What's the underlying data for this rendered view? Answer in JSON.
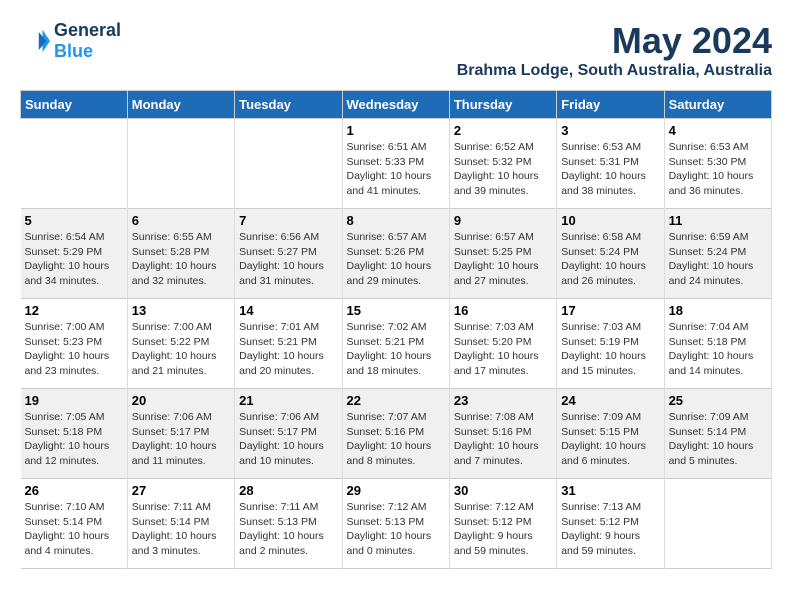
{
  "header": {
    "logo_line1": "General",
    "logo_line2": "Blue",
    "title": "May 2024",
    "subtitle": "Brahma Lodge, South Australia, Australia"
  },
  "weekdays": [
    "Sunday",
    "Monday",
    "Tuesday",
    "Wednesday",
    "Thursday",
    "Friday",
    "Saturday"
  ],
  "weeks": [
    [
      {
        "day": "",
        "info": ""
      },
      {
        "day": "",
        "info": ""
      },
      {
        "day": "",
        "info": ""
      },
      {
        "day": "1",
        "info": "Sunrise: 6:51 AM\nSunset: 5:33 PM\nDaylight: 10 hours\nand 41 minutes."
      },
      {
        "day": "2",
        "info": "Sunrise: 6:52 AM\nSunset: 5:32 PM\nDaylight: 10 hours\nand 39 minutes."
      },
      {
        "day": "3",
        "info": "Sunrise: 6:53 AM\nSunset: 5:31 PM\nDaylight: 10 hours\nand 38 minutes."
      },
      {
        "day": "4",
        "info": "Sunrise: 6:53 AM\nSunset: 5:30 PM\nDaylight: 10 hours\nand 36 minutes."
      }
    ],
    [
      {
        "day": "5",
        "info": "Sunrise: 6:54 AM\nSunset: 5:29 PM\nDaylight: 10 hours\nand 34 minutes."
      },
      {
        "day": "6",
        "info": "Sunrise: 6:55 AM\nSunset: 5:28 PM\nDaylight: 10 hours\nand 32 minutes."
      },
      {
        "day": "7",
        "info": "Sunrise: 6:56 AM\nSunset: 5:27 PM\nDaylight: 10 hours\nand 31 minutes."
      },
      {
        "day": "8",
        "info": "Sunrise: 6:57 AM\nSunset: 5:26 PM\nDaylight: 10 hours\nand 29 minutes."
      },
      {
        "day": "9",
        "info": "Sunrise: 6:57 AM\nSunset: 5:25 PM\nDaylight: 10 hours\nand 27 minutes."
      },
      {
        "day": "10",
        "info": "Sunrise: 6:58 AM\nSunset: 5:24 PM\nDaylight: 10 hours\nand 26 minutes."
      },
      {
        "day": "11",
        "info": "Sunrise: 6:59 AM\nSunset: 5:24 PM\nDaylight: 10 hours\nand 24 minutes."
      }
    ],
    [
      {
        "day": "12",
        "info": "Sunrise: 7:00 AM\nSunset: 5:23 PM\nDaylight: 10 hours\nand 23 minutes."
      },
      {
        "day": "13",
        "info": "Sunrise: 7:00 AM\nSunset: 5:22 PM\nDaylight: 10 hours\nand 21 minutes."
      },
      {
        "day": "14",
        "info": "Sunrise: 7:01 AM\nSunset: 5:21 PM\nDaylight: 10 hours\nand 20 minutes."
      },
      {
        "day": "15",
        "info": "Sunrise: 7:02 AM\nSunset: 5:21 PM\nDaylight: 10 hours\nand 18 minutes."
      },
      {
        "day": "16",
        "info": "Sunrise: 7:03 AM\nSunset: 5:20 PM\nDaylight: 10 hours\nand 17 minutes."
      },
      {
        "day": "17",
        "info": "Sunrise: 7:03 AM\nSunset: 5:19 PM\nDaylight: 10 hours\nand 15 minutes."
      },
      {
        "day": "18",
        "info": "Sunrise: 7:04 AM\nSunset: 5:18 PM\nDaylight: 10 hours\nand 14 minutes."
      }
    ],
    [
      {
        "day": "19",
        "info": "Sunrise: 7:05 AM\nSunset: 5:18 PM\nDaylight: 10 hours\nand 12 minutes."
      },
      {
        "day": "20",
        "info": "Sunrise: 7:06 AM\nSunset: 5:17 PM\nDaylight: 10 hours\nand 11 minutes."
      },
      {
        "day": "21",
        "info": "Sunrise: 7:06 AM\nSunset: 5:17 PM\nDaylight: 10 hours\nand 10 minutes."
      },
      {
        "day": "22",
        "info": "Sunrise: 7:07 AM\nSunset: 5:16 PM\nDaylight: 10 hours\nand 8 minutes."
      },
      {
        "day": "23",
        "info": "Sunrise: 7:08 AM\nSunset: 5:16 PM\nDaylight: 10 hours\nand 7 minutes."
      },
      {
        "day": "24",
        "info": "Sunrise: 7:09 AM\nSunset: 5:15 PM\nDaylight: 10 hours\nand 6 minutes."
      },
      {
        "day": "25",
        "info": "Sunrise: 7:09 AM\nSunset: 5:14 PM\nDaylight: 10 hours\nand 5 minutes."
      }
    ],
    [
      {
        "day": "26",
        "info": "Sunrise: 7:10 AM\nSunset: 5:14 PM\nDaylight: 10 hours\nand 4 minutes."
      },
      {
        "day": "27",
        "info": "Sunrise: 7:11 AM\nSunset: 5:14 PM\nDaylight: 10 hours\nand 3 minutes."
      },
      {
        "day": "28",
        "info": "Sunrise: 7:11 AM\nSunset: 5:13 PM\nDaylight: 10 hours\nand 2 minutes."
      },
      {
        "day": "29",
        "info": "Sunrise: 7:12 AM\nSunset: 5:13 PM\nDaylight: 10 hours\nand 0 minutes."
      },
      {
        "day": "30",
        "info": "Sunrise: 7:12 AM\nSunset: 5:12 PM\nDaylight: 9 hours\nand 59 minutes."
      },
      {
        "day": "31",
        "info": "Sunrise: 7:13 AM\nSunset: 5:12 PM\nDaylight: 9 hours\nand 59 minutes."
      },
      {
        "day": "",
        "info": ""
      }
    ]
  ]
}
